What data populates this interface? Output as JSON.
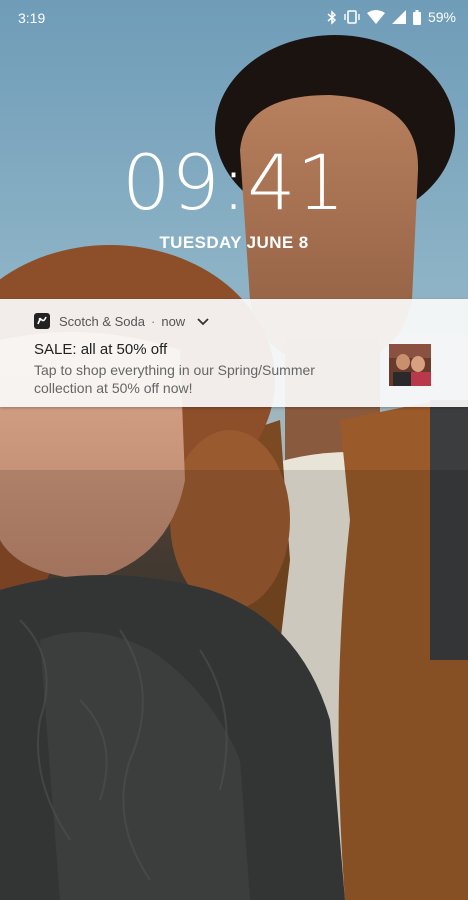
{
  "status_bar": {
    "time": "3:19",
    "battery_percent": "59%",
    "icons": [
      "bluetooth-icon",
      "vibrate-icon",
      "wifi-icon",
      "cell-signal-icon",
      "battery-icon"
    ]
  },
  "lockscreen": {
    "clock": "09:41",
    "date": "TUESDAY JUNE 8"
  },
  "notification": {
    "app_name": "Scotch & Soda",
    "separator": "·",
    "time": "now",
    "title": "SALE: all at 50% off",
    "body": "Tap to shop everything in our Spring/Summer collection at 50% off now!",
    "app_icon": "scotch-soda-logo-icon",
    "expand_icon": "chevron-down-icon"
  },
  "colors": {
    "sky": "#7fa6bf",
    "notification_bg": "#fafafa",
    "jacket": "#9a5a2a"
  }
}
